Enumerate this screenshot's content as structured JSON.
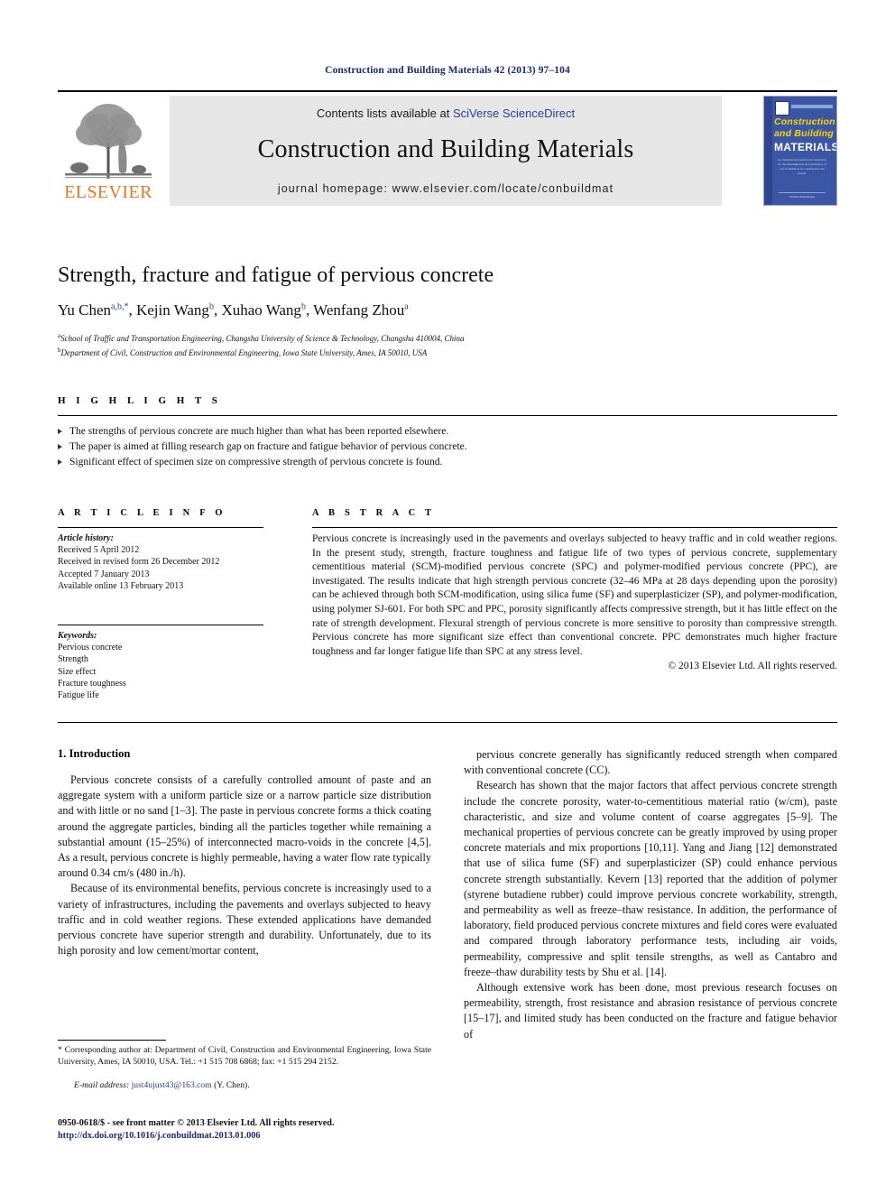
{
  "running_head": "Construction and Building Materials 42 (2013) 97–104",
  "masthead": {
    "publisher_logo_label": "ELSEVIER",
    "contents_prefix": "Contents lists available at ",
    "contents_link": "SciVerse ScienceDirect",
    "journal_title": "Construction and Building Materials",
    "homepage_label": "journal homepage: www.elsevier.com/locate/conbuildmat",
    "cover": {
      "line1": "Construction",
      "line2": "and Building",
      "line3": "MATERIALS",
      "blurb": "An international journal and conference for the dissemination and translation of use of Materials in Construction and Repair",
      "footer": "Elsevier International"
    },
    "accent_gray": "#e6e6e6",
    "link_blue": "#2b3e91",
    "elsevier_orange": "#E87722",
    "cover_blue": "#3b56a5",
    "cover_yellow": "#ffd400"
  },
  "article": {
    "title": "Strength, fracture and fatigue of pervious concrete",
    "authors": [
      {
        "name": "Yu Chen",
        "sup": "a,b,*"
      },
      {
        "name": "Kejin Wang",
        "sup": "b"
      },
      {
        "name": "Xuhao Wang",
        "sup": "b"
      },
      {
        "name": "Wenfang Zhou",
        "sup": "a"
      }
    ],
    "affiliations": [
      {
        "mark": "a",
        "text": "School of Traffic and Transportation Engineering, Changsha University of Science & Technology, Changsha 410004, China"
      },
      {
        "mark": "b",
        "text": "Department of Civil, Construction and Environmental Engineering, Iowa State University, Ames, IA 50010, USA"
      }
    ]
  },
  "highlights": {
    "heading": "H I G H L I G H T S",
    "items": [
      "The strengths of pervious concrete are much higher than what has been reported elsewhere.",
      "The paper is aimed at filling research gap on fracture and fatigue behavior of pervious concrete.",
      "Significant effect of specimen size on compressive strength of pervious concrete is found."
    ]
  },
  "article_info": {
    "heading": "A R T I C L E   I N F O",
    "history_label": "Article history:",
    "history": [
      "Received 5 April 2012",
      "Received in revised form 26 December 2012",
      "Accepted 7 January 2013",
      "Available online 13 February 2013"
    ],
    "keywords_label": "Keywords:",
    "keywords": [
      "Pervious concrete",
      "Strength",
      "Size effect",
      "Fracture toughness",
      "Fatigue life"
    ]
  },
  "abstract": {
    "heading": "A B S T R A C T",
    "text": "Pervious concrete is increasingly used in the pavements and overlays subjected to heavy traffic and in cold weather regions. In the present study, strength, fracture toughness and fatigue life of two types of pervious concrete, supplementary cementitious material (SCM)-modified pervious concrete (SPC) and polymer-modified pervious concrete (PPC), are investigated. The results indicate that high strength pervious concrete (32–46 MPa at 28 days depending upon the porosity) can be achieved through both SCM-modification, using silica fume (SF) and superplasticizer (SP), and polymer-modification, using polymer SJ-601. For both SPC and PPC, porosity significantly affects compressive strength, but it has little effect on the rate of strength development. Flexural strength of pervious concrete is more sensitive to porosity than compressive strength. Pervious concrete has more significant size effect than conventional concrete. PPC demonstrates much higher fracture toughness and far longer fatigue life than SPC at any stress level.",
    "copyright": "© 2013 Elsevier Ltd. All rights reserved."
  },
  "body": {
    "section_heading": "1. Introduction",
    "left_paragraphs": [
      "Pervious concrete consists of a carefully controlled amount of paste and an aggregate system with a uniform particle size or a narrow particle size distribution and with little or no sand [1–3]. The paste in pervious concrete forms a thick coating around the aggregate particles, binding all the particles together while remaining a substantial amount (15–25%) of interconnected macro-voids in the concrete [4,5]. As a result, pervious concrete is highly permeable, having a water flow rate typically around 0.34 cm/s (480 in./h).",
      "Because of its environmental benefits, pervious concrete is increasingly used to a variety of infrastructures, including the pavements and overlays subjected to heavy traffic and in cold weather regions. These extended applications have demanded pervious concrete have superior strength and durability. Unfortunately, due to its high porosity and low cement/mortar content,"
    ],
    "right_paragraphs": [
      "pervious concrete generally has significantly reduced strength when compared with conventional concrete (CC).",
      "Research has shown that the major factors that affect pervious concrete strength include the concrete porosity, water-to-cementitious material ratio (w/cm), paste characteristic, and size and volume content of coarse aggregates [5–9]. The mechanical properties of pervious concrete can be greatly improved by using proper concrete materials and mix proportions [10,11]. Yang and Jiang [12] demonstrated that use of silica fume (SF) and superplasticizer (SP) could enhance pervious concrete strength substantially. Kevern [13] reported that the addition of polymer (styrene butadiene rubber) could improve pervious concrete workability, strength, and permeability as well as freeze–thaw resistance. In addition, the performance of laboratory, field produced pervious concrete mixtures and field cores were evaluated and compared through laboratory performance tests, including air voids, permeability, compressive and split tensile strengths, as well as Cantabro and freeze–thaw durability tests by Shu et al. [14].",
      "Although extensive work has been done, most previous research focuses on permeability, strength, frost resistance and abrasion resistance of pervious concrete [15–17], and limited study has been conducted on the fracture and fatigue behavior of"
    ]
  },
  "footnotes": {
    "corresponding": "* Corresponding author at: Department of Civil, Construction and Environmental Engineering, Iowa State University, Ames, IA 50010, USA. Tel.: +1 515 708 6868; fax: +1 515 294 2152.",
    "email_label": "E-mail address:",
    "email": "just4ujust43@163.com",
    "email_suffix": "(Y. Chen)."
  },
  "imprint": {
    "line1": "0950-0618/$ - see front matter © 2013 Elsevier Ltd. All rights reserved.",
    "doi": "http://dx.doi.org/10.1016/j.conbuildmat.2013.01.006"
  }
}
